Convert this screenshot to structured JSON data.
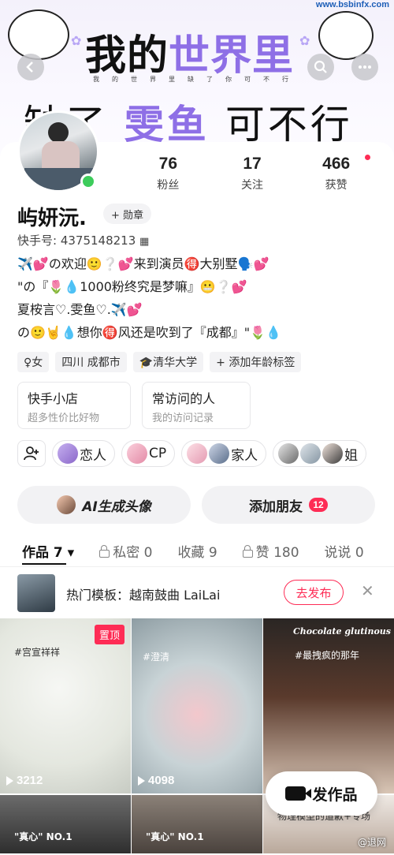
{
  "banner": {
    "watermark": "www.bsbinfx.com",
    "line1_prefix": "我的",
    "line1_purple": "世界里",
    "small_line": "我的世界里缺了你可不行",
    "line2_left": "缺了",
    "line2_purple": "雯鱼",
    "line2_right": "可不行"
  },
  "top_nav": {
    "back_icon": "chevron-left-icon",
    "search_icon": "search-icon",
    "more_icon": "more-dots-icon"
  },
  "profile": {
    "name": "屿妍沅.",
    "medal_label": "+ 勋章",
    "kuaishou_id": "快手号: 4375148213",
    "online_color": "#3dcc5b"
  },
  "stats": [
    {
      "value": "76",
      "label": "粉丝"
    },
    {
      "value": "17",
      "label": "关注"
    },
    {
      "value": "466",
      "label": "获赞"
    }
  ],
  "bio": [
    "✈️💕の欢迎🙂❔💕来到演员🉐大别墅🗣️💕",
    "\"の『🌷💧1000粉终究是梦嘛』😬❔💕",
    "夏桉言♡.雯鱼♡.✈️💕",
    "の🙂🤘💧想你🉐风还是吹到了『成都』\"🌷💧"
  ],
  "tags": [
    "♀女",
    "四川 成都市",
    "🎓清华大学",
    "+ 添加年龄标签"
  ],
  "entries": [
    {
      "title": "快手小店",
      "subtitle": "超多性价比好物"
    },
    {
      "title": "常访问的人",
      "subtitle": "我的访问记录"
    }
  ],
  "relations": [
    "恋人",
    "CP",
    "家人",
    "姐"
  ],
  "buttons": {
    "ai_avatar": "AI生成头像",
    "add_friend": "添加朋友",
    "add_friend_badge": "12"
  },
  "tabs": [
    {
      "label": "作品 7 ▾",
      "locked": false,
      "active": true
    },
    {
      "label": "私密 0",
      "locked": true,
      "active": false
    },
    {
      "label": "收藏 9",
      "locked": false,
      "active": false
    },
    {
      "label": "赞 180",
      "locked": true,
      "active": false
    },
    {
      "label": "说说 0",
      "locked": false,
      "active": false
    }
  ],
  "hot_template": {
    "text": "热门模板：越南鼓曲 LaiLai",
    "action": "去发布",
    "close": "✕"
  },
  "videos": [
    {
      "plays": "3212",
      "pinned": "置顶",
      "caption": "#宫宣祥祥"
    },
    {
      "plays": "4098",
      "pinned": "",
      "caption": "#澄清"
    },
    {
      "plays": "",
      "pinned": "",
      "caption": "#最拽疯的那年",
      "header": "Chocolate glutinous"
    }
  ],
  "row2_captions": [
    "\"真心\" NO.1",
    "\"真心\" NO.1",
    "物理模型的道歉+专场"
  ],
  "publish_label": "发作品",
  "footer_watermark": "@退网"
}
